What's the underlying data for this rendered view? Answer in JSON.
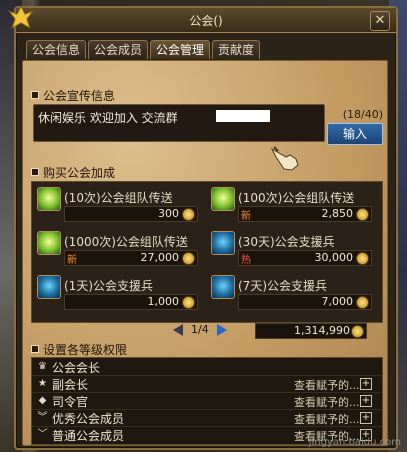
{
  "window": {
    "title": "公会()"
  },
  "tabs": [
    "公会信息",
    "公会成员",
    "公会管理",
    "贡献度"
  ],
  "announcement": {
    "section_title": "公会宣传信息",
    "text": "休闲娱乐  欢迎加入  交流群",
    "counter": "(18/40)",
    "submit_label": "输入"
  },
  "buy": {
    "section_title": "购买公会加成",
    "items": [
      {
        "name": "(10次)公会组队传送",
        "tag": "",
        "price": "300",
        "icon": "green-orb-icon"
      },
      {
        "name": "(100次)公会组队传送",
        "tag": "新",
        "price": "2,850",
        "icon": "green-orb-icon"
      },
      {
        "name": "(1000次)公会组队传送",
        "tag": "新",
        "price": "27,000",
        "icon": "green-orb-icon"
      },
      {
        "name": "(30天)公会支援兵",
        "tag": "热",
        "price": "30,000",
        "icon": "blue-soldier-icon"
      },
      {
        "name": "(1天)公会支援兵",
        "tag": "",
        "price": "1,000",
        "icon": "blue-soldier-icon"
      },
      {
        "name": "(7天)公会支援兵",
        "tag": "",
        "price": "7,000",
        "icon": "blue-soldier-icon"
      }
    ],
    "page": "1/4",
    "total": "1,314,990"
  },
  "permissions": {
    "section_title": "设置各等级权限",
    "rows": [
      {
        "label": "公会会长",
        "link": ""
      },
      {
        "label": "副会长",
        "link": "查看赋予的..."
      },
      {
        "label": "司令官",
        "link": "查看赋予的..."
      },
      {
        "label": "优秀公会成员",
        "link": "查看赋予的..."
      },
      {
        "label": "普通公会成员",
        "link": "查看赋予的..."
      }
    ]
  },
  "watermark": "jingyan.baidu.com"
}
